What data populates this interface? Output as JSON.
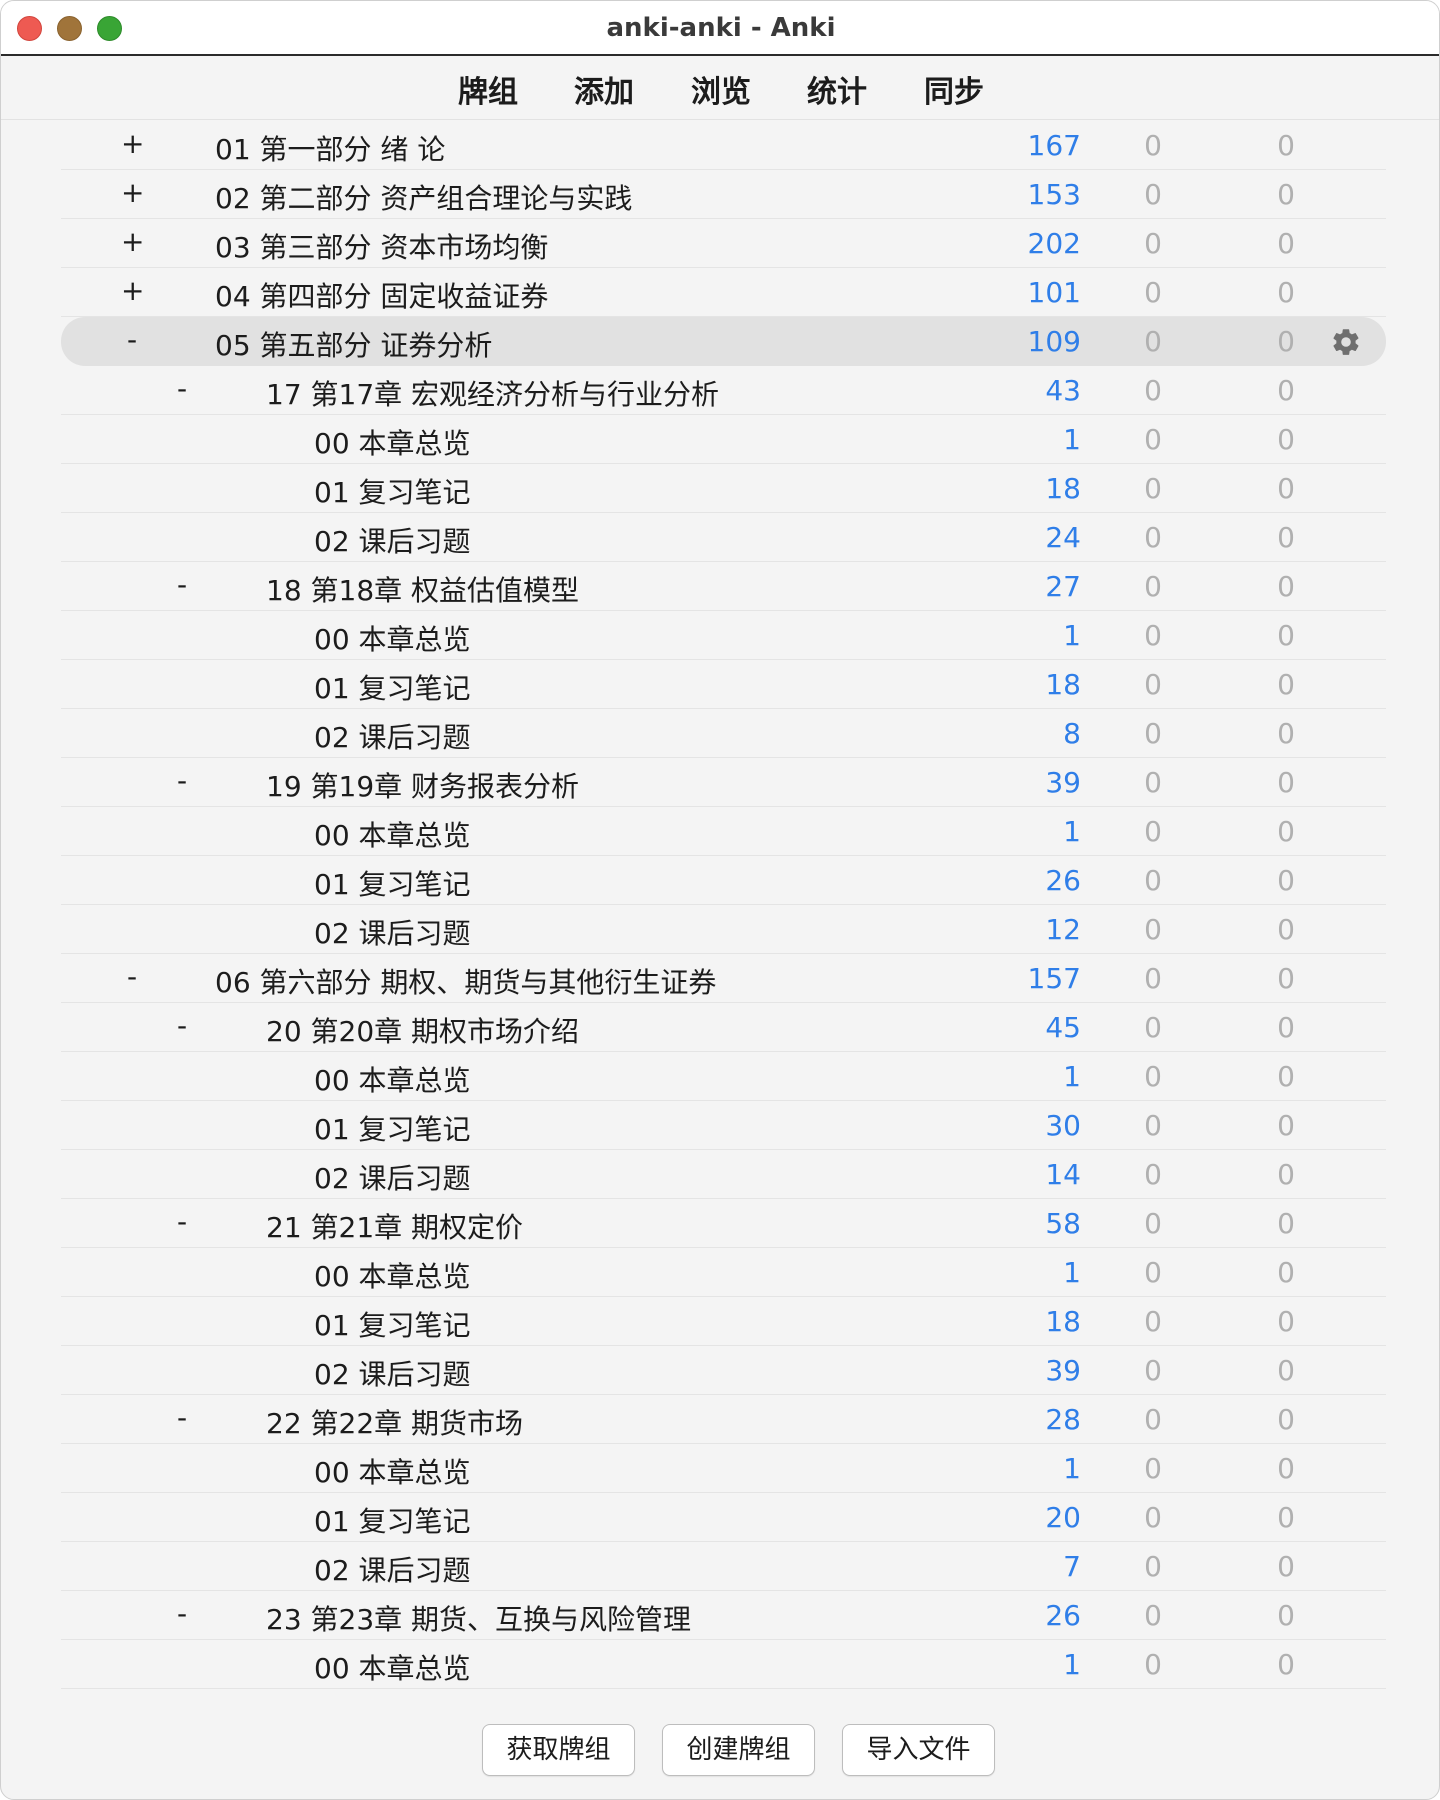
{
  "window": {
    "title": "anki-anki - Anki"
  },
  "toolbar": [
    {
      "label": "牌组"
    },
    {
      "label": "添加"
    },
    {
      "label": "浏览"
    },
    {
      "label": "统计"
    },
    {
      "label": "同步"
    }
  ],
  "decks": [
    {
      "toggle": "+",
      "name": "01 第一部分 绪 论",
      "new": "167",
      "learn": "0",
      "due": "0",
      "level": 0
    },
    {
      "toggle": "+",
      "name": "02 第二部分 资产组合理论与实践",
      "new": "153",
      "learn": "0",
      "due": "0",
      "level": 0
    },
    {
      "toggle": "+",
      "name": "03 第三部分 资本市场均衡",
      "new": "202",
      "learn": "0",
      "due": "0",
      "level": 0
    },
    {
      "toggle": "+",
      "name": "04 第四部分 固定收益证券",
      "new": "101",
      "learn": "0",
      "due": "0",
      "level": 0
    },
    {
      "toggle": "-",
      "name": "05 第五部分 证券分析",
      "new": "109",
      "learn": "0",
      "due": "0",
      "level": 0,
      "selected": true
    },
    {
      "toggle": "-",
      "name": "17 第17章 宏观经济分析与行业分析",
      "new": "43",
      "learn": "0",
      "due": "0",
      "level": 1
    },
    {
      "toggle": "",
      "name": "00 本章总览",
      "new": "1",
      "learn": "0",
      "due": "0",
      "level": 2
    },
    {
      "toggle": "",
      "name": "01 复习笔记",
      "new": "18",
      "learn": "0",
      "due": "0",
      "level": 2
    },
    {
      "toggle": "",
      "name": "02 课后习题",
      "new": "24",
      "learn": "0",
      "due": "0",
      "level": 2
    },
    {
      "toggle": "-",
      "name": "18 第18章 权益估值模型",
      "new": "27",
      "learn": "0",
      "due": "0",
      "level": 1
    },
    {
      "toggle": "",
      "name": "00 本章总览",
      "new": "1",
      "learn": "0",
      "due": "0",
      "level": 2
    },
    {
      "toggle": "",
      "name": "01 复习笔记",
      "new": "18",
      "learn": "0",
      "due": "0",
      "level": 2
    },
    {
      "toggle": "",
      "name": "02 课后习题",
      "new": "8",
      "learn": "0",
      "due": "0",
      "level": 2
    },
    {
      "toggle": "-",
      "name": "19 第19章 财务报表分析",
      "new": "39",
      "learn": "0",
      "due": "0",
      "level": 1
    },
    {
      "toggle": "",
      "name": "00 本章总览",
      "new": "1",
      "learn": "0",
      "due": "0",
      "level": 2
    },
    {
      "toggle": "",
      "name": "01 复习笔记",
      "new": "26",
      "learn": "0",
      "due": "0",
      "level": 2
    },
    {
      "toggle": "",
      "name": "02 课后习题",
      "new": "12",
      "learn": "0",
      "due": "0",
      "level": 2
    },
    {
      "toggle": "-",
      "name": "06 第六部分 期权、期货与其他衍生证券",
      "new": "157",
      "learn": "0",
      "due": "0",
      "level": 0
    },
    {
      "toggle": "-",
      "name": "20 第20章 期权市场介绍",
      "new": "45",
      "learn": "0",
      "due": "0",
      "level": 1
    },
    {
      "toggle": "",
      "name": "00 本章总览",
      "new": "1",
      "learn": "0",
      "due": "0",
      "level": 2
    },
    {
      "toggle": "",
      "name": "01 复习笔记",
      "new": "30",
      "learn": "0",
      "due": "0",
      "level": 2
    },
    {
      "toggle": "",
      "name": "02 课后习题",
      "new": "14",
      "learn": "0",
      "due": "0",
      "level": 2
    },
    {
      "toggle": "-",
      "name": "21 第21章 期权定价",
      "new": "58",
      "learn": "0",
      "due": "0",
      "level": 1
    },
    {
      "toggle": "",
      "name": "00 本章总览",
      "new": "1",
      "learn": "0",
      "due": "0",
      "level": 2
    },
    {
      "toggle": "",
      "name": "01 复习笔记",
      "new": "18",
      "learn": "0",
      "due": "0",
      "level": 2
    },
    {
      "toggle": "",
      "name": "02 课后习题",
      "new": "39",
      "learn": "0",
      "due": "0",
      "level": 2
    },
    {
      "toggle": "-",
      "name": "22 第22章 期货市场",
      "new": "28",
      "learn": "0",
      "due": "0",
      "level": 1
    },
    {
      "toggle": "",
      "name": "00 本章总览",
      "new": "1",
      "learn": "0",
      "due": "0",
      "level": 2
    },
    {
      "toggle": "",
      "name": "01 复习笔记",
      "new": "20",
      "learn": "0",
      "due": "0",
      "level": 2
    },
    {
      "toggle": "",
      "name": "02 课后习题",
      "new": "7",
      "learn": "0",
      "due": "0",
      "level": 2
    },
    {
      "toggle": "-",
      "name": "23 第23章 期货、互换与风险管理",
      "new": "26",
      "learn": "0",
      "due": "0",
      "level": 1
    },
    {
      "toggle": "",
      "name": "00 本章总览",
      "new": "1",
      "learn": "0",
      "due": "0",
      "level": 2
    }
  ],
  "footer": {
    "get_shared": "获取牌组",
    "create_deck": "创建牌组",
    "import_file": "导入文件"
  },
  "colors": {
    "new_count": "#2f7ee8",
    "zero_count": "#b0b0b0",
    "selected_row": "#e1e1e1"
  },
  "icons": {
    "deck_options": "gear-icon"
  }
}
